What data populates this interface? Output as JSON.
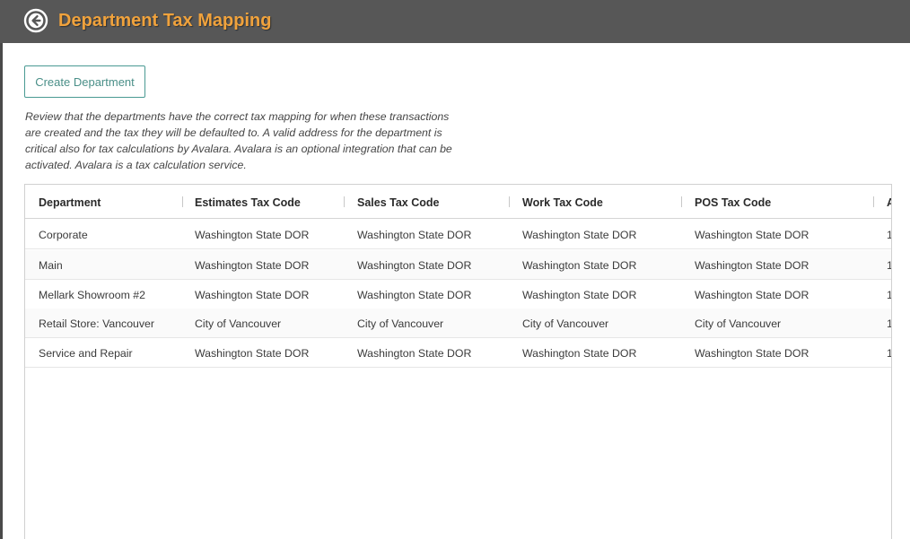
{
  "header": {
    "title": "Department Tax Mapping",
    "back_icon": "back-arrow-circle-icon",
    "title_color": "#f0a23c",
    "bar_color": "#575757"
  },
  "toolbar": {
    "create_label": "Create Department",
    "accent_color": "#4a9a93"
  },
  "description": "Review that the departments have the correct tax mapping for when these transactions are created and the tax they will be defaulted to. A valid address for the department is critical also for tax calculations by Avalara. Avalara is an optional integration that can be activated. Avalara is a tax calculation service.",
  "table": {
    "columns": [
      "Department",
      "Estimates Tax Code",
      "Sales Tax Code",
      "Work Tax Code",
      "POS Tax Code",
      "A"
    ],
    "rows": [
      [
        "Corporate",
        "Washington State DOR",
        "Washington State DOR",
        "Washington State DOR",
        "Washington State DOR",
        "1"
      ],
      [
        "Main",
        "Washington State DOR",
        "Washington State DOR",
        "Washington State DOR",
        "Washington State DOR",
        "1"
      ],
      [
        "Mellark Showroom #2",
        "Washington State DOR",
        "Washington State DOR",
        "Washington State DOR",
        "Washington State DOR",
        "1"
      ],
      [
        "Retail Store: Vancouver",
        "City of Vancouver",
        "City of Vancouver",
        "City of Vancouver",
        "City of Vancouver",
        "1"
      ],
      [
        "Service and Repair",
        "Washington State DOR",
        "Washington State DOR",
        "Washington State DOR",
        "Washington State DOR",
        "1"
      ]
    ]
  }
}
